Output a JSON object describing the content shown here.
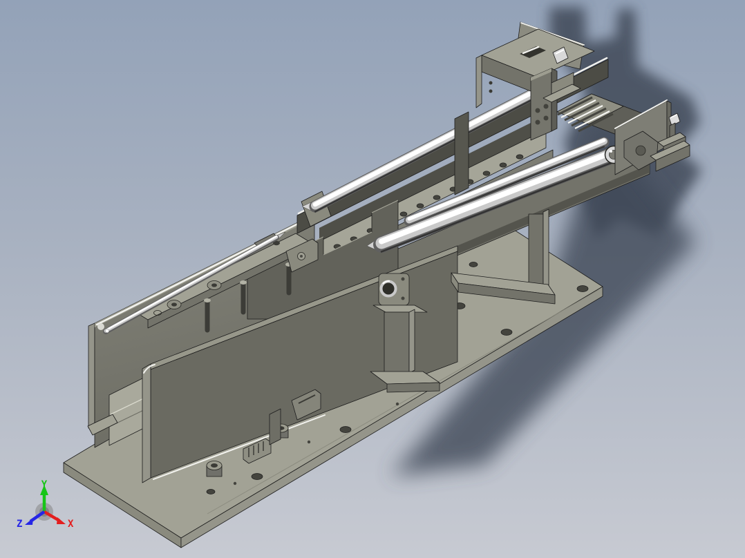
{
  "viewport": {
    "background_top": "#93a2b8",
    "background_mid": "#a9b2c1",
    "background_bottom": "#c7cad2"
  },
  "axis_triad": {
    "x_label": "X",
    "y_label": "Y",
    "z_label": "Z",
    "x_color": "#e31e1e",
    "y_color": "#17c517",
    "z_color": "#2525e6"
  },
  "model": {
    "parts": [
      "base-plate",
      "left-side-wall",
      "carriage-plate",
      "front-cover-plate",
      "guide-rail-upper",
      "perforated-rail",
      "guide-rod-upper",
      "guide-rod-lower",
      "secondary-rod",
      "push-rod",
      "shaft-support-block",
      "support-pillar",
      "support-foot",
      "end-bracket-left",
      "end-bracket-right",
      "rod-end-flange",
      "mounting-boss",
      "terminal-block"
    ]
  },
  "colors": {
    "face_top": "#a2a295",
    "face_top_bright": "#b3b3a5",
    "face_front": "#73736a",
    "face_side": "#8a8a7e",
    "face_side_light": "#95958a",
    "plate_dark": "#6a6a61",
    "carriage_dark": "#62625a",
    "wall_light": "#84847a",
    "wall_dark": "#6d6d64",
    "rail_light": "#a5a598",
    "rail_mid": "#7d7d73",
    "rail_dark": "#4c4c45",
    "interior_light": "#a9a99c",
    "hole": "#44443e",
    "edge": "#1c1c1c",
    "highlight": "#f2f2ee",
    "chrome_light": "#ffffff",
    "chrome_mid": "#c9c9c9",
    "chrome_dark": "#606060",
    "chrome_shade": "#333333",
    "shadow": "#3f4858"
  }
}
